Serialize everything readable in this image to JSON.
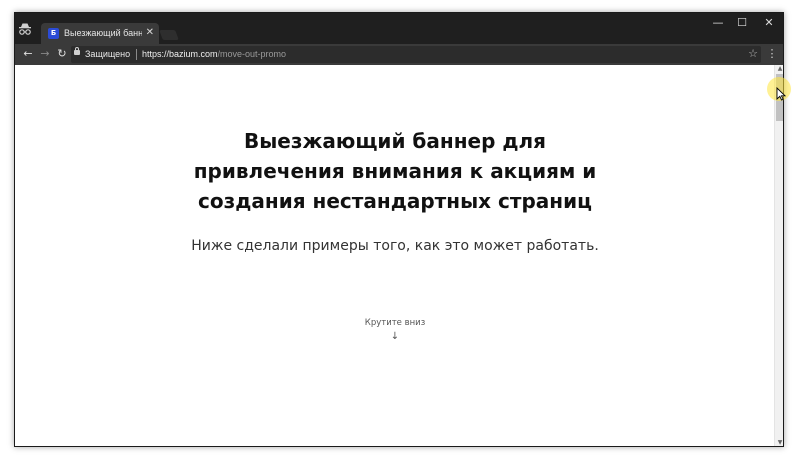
{
  "browser": {
    "tab": {
      "favicon_letter": "Б",
      "title": "Выезжающий баннер н",
      "close": "✕"
    },
    "window_controls": {
      "minimize": "—",
      "maximize": "☐",
      "close": "✕"
    },
    "nav": {
      "back": "←",
      "forward": "→",
      "reload": "↻"
    },
    "address": {
      "secure_label": "Защищено",
      "url_main": "https://bazium.com",
      "url_path": "/move-out-promo"
    },
    "star": "☆",
    "menu": "⋮",
    "scroll_up": "▲",
    "scroll_down": "▼"
  },
  "page": {
    "heading_lines": [
      "Выезжающий баннер для",
      "привлечения внимания к акциям и",
      "создания нестандартных страниц"
    ],
    "subtitle": "Ниже сделали примеры того, как это может работать.",
    "scroll_hint": "Крутите вниз",
    "scroll_arrow": "↓"
  },
  "colors": {
    "titlebar": "#1f1f1f",
    "toolbar": "#3a3a3a",
    "favicon": "#2b4bd6",
    "cursor_highlight": "#ffe63c"
  },
  "icons": [
    "incognito-icon",
    "close-icon",
    "back-icon",
    "forward-icon",
    "reload-icon",
    "lock-icon",
    "star-icon",
    "menu-icon",
    "down-arrow-icon",
    "cursor-icon"
  ]
}
